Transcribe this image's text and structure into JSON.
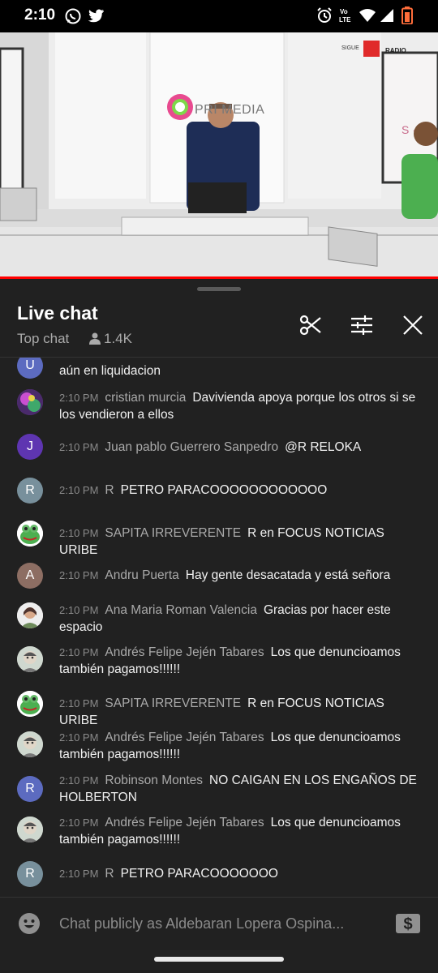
{
  "status_bar": {
    "time": "2:10",
    "icons": [
      "whatsapp-icon",
      "twitter-icon",
      "alarm-icon",
      "volte-icon",
      "wifi-icon",
      "signal-icon",
      "battery-icon"
    ],
    "volte_label": "Vo LTE"
  },
  "video": {
    "studio_logo_text": "PRI   MEDIA",
    "brand_small": "SIGUE",
    "brand_radio": "RADIO",
    "progress_color": "#ff0000"
  },
  "live_chat": {
    "title": "Live chat",
    "mode": "Top chat",
    "viewer_count": "1.4K",
    "buttons": [
      "scissors-icon",
      "filter-icon",
      "close-icon"
    ]
  },
  "messages": [
    {
      "time": "",
      "author": "",
      "text": "aún en liquidacion",
      "avatar_letter": "U",
      "avatar_color": "#5c6bc0"
    },
    {
      "time": "2:10 PM",
      "author": "cristian murcia",
      "text": "Davivienda apoya porque los otros si se los vendieron a ellos",
      "avatar_letter": "",
      "avatar_color": "#7b4ea0"
    },
    {
      "time": "2:10 PM",
      "author": "Juan pablo Guerrero Sanpedro",
      "text": "@R RELOKA",
      "avatar_letter": "J",
      "avatar_color": "#5e35b1"
    },
    {
      "time": "2:10 PM",
      "author": "R",
      "text": "PETRO PARACOOOOOOOOOOOO",
      "avatar_letter": "R",
      "avatar_color": "#78909c"
    },
    {
      "time": "2:10 PM",
      "author": "SAPITA IRREVERENTE",
      "text": "R en FOCUS NOTICIAS URIBE",
      "avatar_letter": "",
      "avatar_color": "#4caf50"
    },
    {
      "time": "2:10 PM",
      "author": "Andru Puerta",
      "text": "Hay gente desacatada y está señora",
      "avatar_letter": "A",
      "avatar_color": "#8d6e63"
    },
    {
      "time": "2:10 PM",
      "author": "Ana Maria Roman Valencia",
      "text": "Gracias por hacer este espacio",
      "avatar_letter": "",
      "avatar_color": "#d7ccc8"
    },
    {
      "time": "2:10 PM",
      "author": "Andrés Felipe Jején Tabares",
      "text": "Los que denuncioamos también pagamos!!!!!!",
      "avatar_letter": "",
      "avatar_color": "#9e9e9e"
    },
    {
      "time": "2:10 PM",
      "author": "SAPITA IRREVERENTE",
      "text": "R en FOCUS NOTICIAS URIBE",
      "avatar_letter": "",
      "avatar_color": "#4caf50"
    },
    {
      "time": "2:10 PM",
      "author": "Andrés Felipe Jején Tabares",
      "text": "Los que denuncioamos también pagamos!!!!!!",
      "avatar_letter": "",
      "avatar_color": "#9e9e9e"
    },
    {
      "time": "2:10 PM",
      "author": "Robinson Montes",
      "text": "NO CAIGAN EN LOS ENGAÑOS DE HOLBERTON",
      "avatar_letter": "R",
      "avatar_color": "#5c6bc0"
    },
    {
      "time": "2:10 PM",
      "author": "Andrés Felipe Jején Tabares",
      "text": "Los que denuncioamos también pagamos!!!!!!",
      "avatar_letter": "",
      "avatar_color": "#9e9e9e"
    },
    {
      "time": "2:10 PM",
      "author": "R",
      "text": "PETRO PARACOOOOOOO",
      "avatar_letter": "R",
      "avatar_color": "#78909c"
    }
  ],
  "input": {
    "placeholder": "Chat publicly as Aldebaran Lopera Ospina...",
    "emoji_icon": "emoji-icon",
    "superchat_icon": "super-chat-dollar-icon"
  }
}
